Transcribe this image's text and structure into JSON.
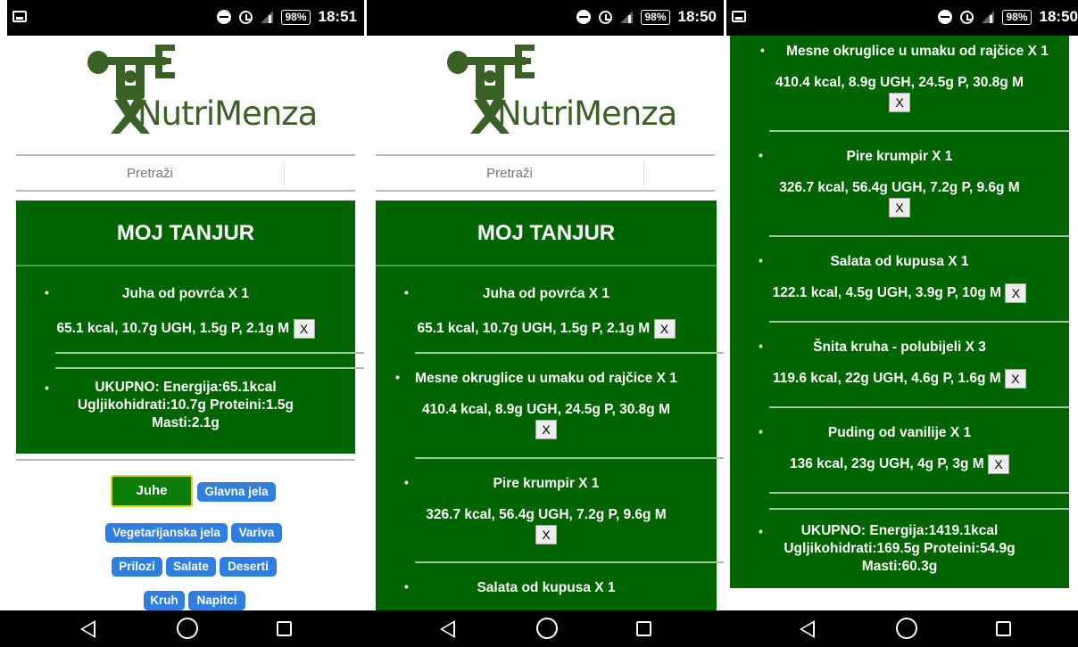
{
  "screens": [
    {
      "status": {
        "battery": "98%",
        "time": "18:51"
      },
      "app": {
        "name": "NutriMenza",
        "search_label": "Pretraži"
      },
      "panel_title": "MOJ TANJUR",
      "items": [
        {
          "name": "Juha od povrća X 1",
          "nutrition": "65.1 kcal, 10.7g UGH, 1.5g P, 2.1g M",
          "remove": "X"
        }
      ],
      "total": {
        "line1": "UKUPNO: Energija:65.1kcal",
        "line2": "Ugljikohidrati:10.7g Proteini:1.5g",
        "line3": "Masti:2.1g"
      },
      "categories": [
        "Juhe",
        "Glavna jela",
        "Vegetarijanska jela",
        "Variva",
        "Prilozi",
        "Salate",
        "Deserti",
        "Kruh",
        "Napitci"
      ]
    },
    {
      "status": {
        "battery": "98%",
        "time": "18:50"
      },
      "app": {
        "name": "NutriMenza",
        "search_label": "Pretraži"
      },
      "panel_title": "MOJ TANJUR",
      "items": [
        {
          "name": "Juha od povrća X 1",
          "nutrition": "65.1 kcal, 10.7g UGH, 1.5g P, 2.1g M",
          "remove": "X"
        },
        {
          "name": "Mesne okruglice u umaku od rajčice X 1",
          "nutrition": "410.4 kcal, 8.9g UGH, 24.5g P, 30.8g M",
          "remove": "X"
        },
        {
          "name": "Pire krumpir X 1",
          "nutrition": "326.7 kcal, 56.4g UGH, 7.2g P, 9.6g M",
          "remove": "X"
        },
        {
          "name": "Salata od kupusa X 1"
        }
      ]
    },
    {
      "status": {
        "battery": "98%",
        "time": "18:50"
      },
      "items": [
        {
          "name": "Mesne okruglice u umaku od rajčice X 1",
          "nutrition": "410.4 kcal, 8.9g UGH, 24.5g P, 30.8g M",
          "remove": "X"
        },
        {
          "name": "Pire krumpir X 1",
          "nutrition": "326.7 kcal, 56.4g UGH, 7.2g P, 9.6g M",
          "remove": "X"
        },
        {
          "name": "Salata od kupusa X 1",
          "nutrition": "122.1 kcal, 4.5g UGH, 3.9g P, 10g M",
          "remove": "X"
        },
        {
          "name": "Šnita kruha - polubijeli X 3",
          "nutrition": "119.6 kcal, 22g UGH, 4.6g P, 1.6g M",
          "remove": "X"
        },
        {
          "name": "Puding od vanilije X 1",
          "nutrition": "136 kcal, 23g UGH, 4g P, 3g M",
          "remove": "X"
        }
      ],
      "total": {
        "line1": "UKUPNO: Energija:1419.1kcal",
        "line2": "Ugljikohidrati:169.5g Proteini:54.9g",
        "line3": "Masti:60.3g"
      }
    }
  ],
  "icons": {
    "statusbar": [
      "screenshot-icon",
      "do-not-disturb-icon",
      "alarm-icon",
      "signal-icon",
      "battery-icon"
    ],
    "navbar": [
      "back-icon",
      "home-icon",
      "recents-icon"
    ]
  },
  "colors": {
    "panel": "#006400",
    "category_button": "#2f7fe0",
    "active_category": "#0a7d0a",
    "logo": "#3a6126"
  }
}
